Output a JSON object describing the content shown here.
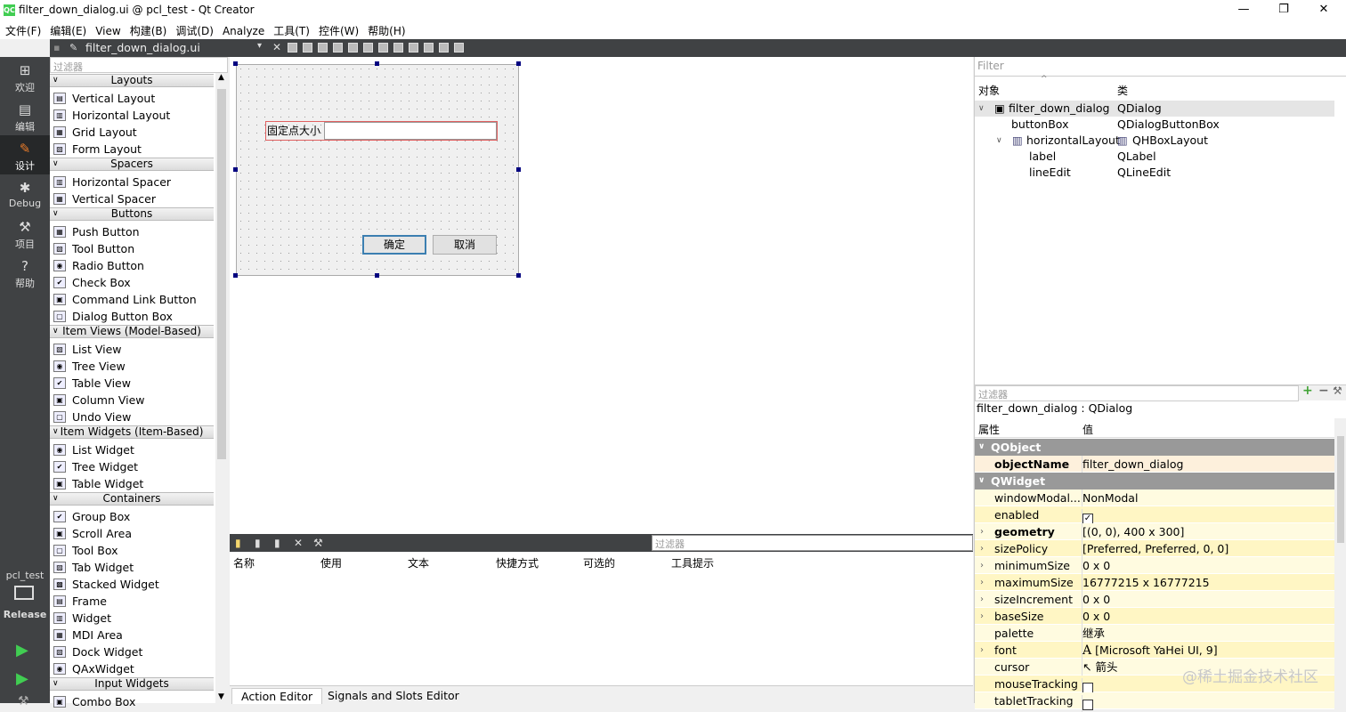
{
  "window": {
    "title": "filter_down_dialog.ui @ pcl_test - Qt Creator",
    "minimize": "—",
    "maximize": "❐",
    "close": "✕"
  },
  "menu": [
    "文件(F)",
    "编辑(E)",
    "View",
    "构建(B)",
    "调试(D)",
    "Analyze",
    "工具(T)",
    "控件(W)",
    "帮助(H)"
  ],
  "editor_toolbar": {
    "file_name": "filter_down_dialog.ui"
  },
  "modes": [
    {
      "label": "欢迎",
      "icon": "grid-icon"
    },
    {
      "label": "编辑",
      "icon": "document-icon"
    },
    {
      "label": "设计",
      "icon": "pencil-icon"
    },
    {
      "label": "Debug",
      "icon": "bug-icon"
    },
    {
      "label": "项目",
      "icon": "wrench-icon"
    },
    {
      "label": "帮助",
      "icon": "help-icon"
    }
  ],
  "kit": {
    "project": "pcl_test",
    "config": "Release"
  },
  "widget_box": {
    "filter_placeholder": "过滤器",
    "categories": [
      {
        "name": "Layouts",
        "items": [
          "Vertical Layout",
          "Horizontal Layout",
          "Grid Layout",
          "Form Layout"
        ]
      },
      {
        "name": "Spacers",
        "items": [
          "Horizontal Spacer",
          "Vertical Spacer"
        ]
      },
      {
        "name": "Buttons",
        "items": [
          "Push Button",
          "Tool Button",
          "Radio Button",
          "Check Box",
          "Command Link Button",
          "Dialog Button Box"
        ]
      },
      {
        "name": "Item Views (Model-Based)",
        "items": [
          "List View",
          "Tree View",
          "Table View",
          "Column View",
          "Undo View"
        ]
      },
      {
        "name": "Item Widgets (Item-Based)",
        "items": [
          "List Widget",
          "Tree Widget",
          "Table Widget"
        ]
      },
      {
        "name": "Containers",
        "items": [
          "Group Box",
          "Scroll Area",
          "Tool Box",
          "Tab Widget",
          "Stacked Widget",
          "Frame",
          "Widget",
          "MDI Area",
          "Dock Widget",
          "QAxWidget"
        ]
      },
      {
        "name": "Input Widgets",
        "items": [
          "Combo Box"
        ]
      }
    ]
  },
  "form": {
    "label": "固定点大小",
    "ok": "确定",
    "cancel": "取消"
  },
  "action_editor": {
    "filter_placeholder": "过滤器",
    "columns": [
      "名称",
      "使用",
      "文本",
      "快捷方式",
      "可选的",
      "工具提示"
    ],
    "tabs": [
      "Action Editor",
      "Signals and Slots Editor"
    ]
  },
  "object_inspector": {
    "filter_placeholder": "Filter",
    "col_object": "对象",
    "col_class": "类",
    "rows": [
      {
        "object": "filter_down_dialog",
        "class": "QDialog"
      },
      {
        "object": "buttonBox",
        "class": "QDialogButtonBox"
      },
      {
        "object": "horizontalLayout",
        "class": "QHBoxLayout"
      },
      {
        "object": "label",
        "class": "QLabel"
      },
      {
        "object": "lineEdit",
        "class": "QLineEdit"
      }
    ]
  },
  "property_editor": {
    "filter_placeholder": "过滤器",
    "class_line": "filter_down_dialog : QDialog",
    "col_property": "属性",
    "col_value": "值",
    "groups": [
      "QObject",
      "QWidget"
    ],
    "properties": [
      {
        "name": "objectName",
        "value": "filter_down_dialog"
      },
      {
        "name": "windowModal...",
        "value": "NonModal"
      },
      {
        "name": "enabled",
        "value": "✓"
      },
      {
        "name": "geometry",
        "value": "[(0, 0), 400 x 300]"
      },
      {
        "name": "sizePolicy",
        "value": "[Preferred, Preferred, 0, 0]"
      },
      {
        "name": "minimumSize",
        "value": "0 x 0"
      },
      {
        "name": "maximumSize",
        "value": "16777215 x 16777215"
      },
      {
        "name": "sizeIncrement",
        "value": "0 x 0"
      },
      {
        "name": "baseSize",
        "value": "0 x 0"
      },
      {
        "name": "palette",
        "value": "继承"
      },
      {
        "name": "font",
        "value": "[Microsoft YaHei UI, 9]"
      },
      {
        "name": "cursor",
        "value": "箭头"
      },
      {
        "name": "mouseTracking",
        "value": ""
      },
      {
        "name": "tabletTracking",
        "value": ""
      }
    ]
  },
  "watermark": "@稀土掘金技术社区"
}
